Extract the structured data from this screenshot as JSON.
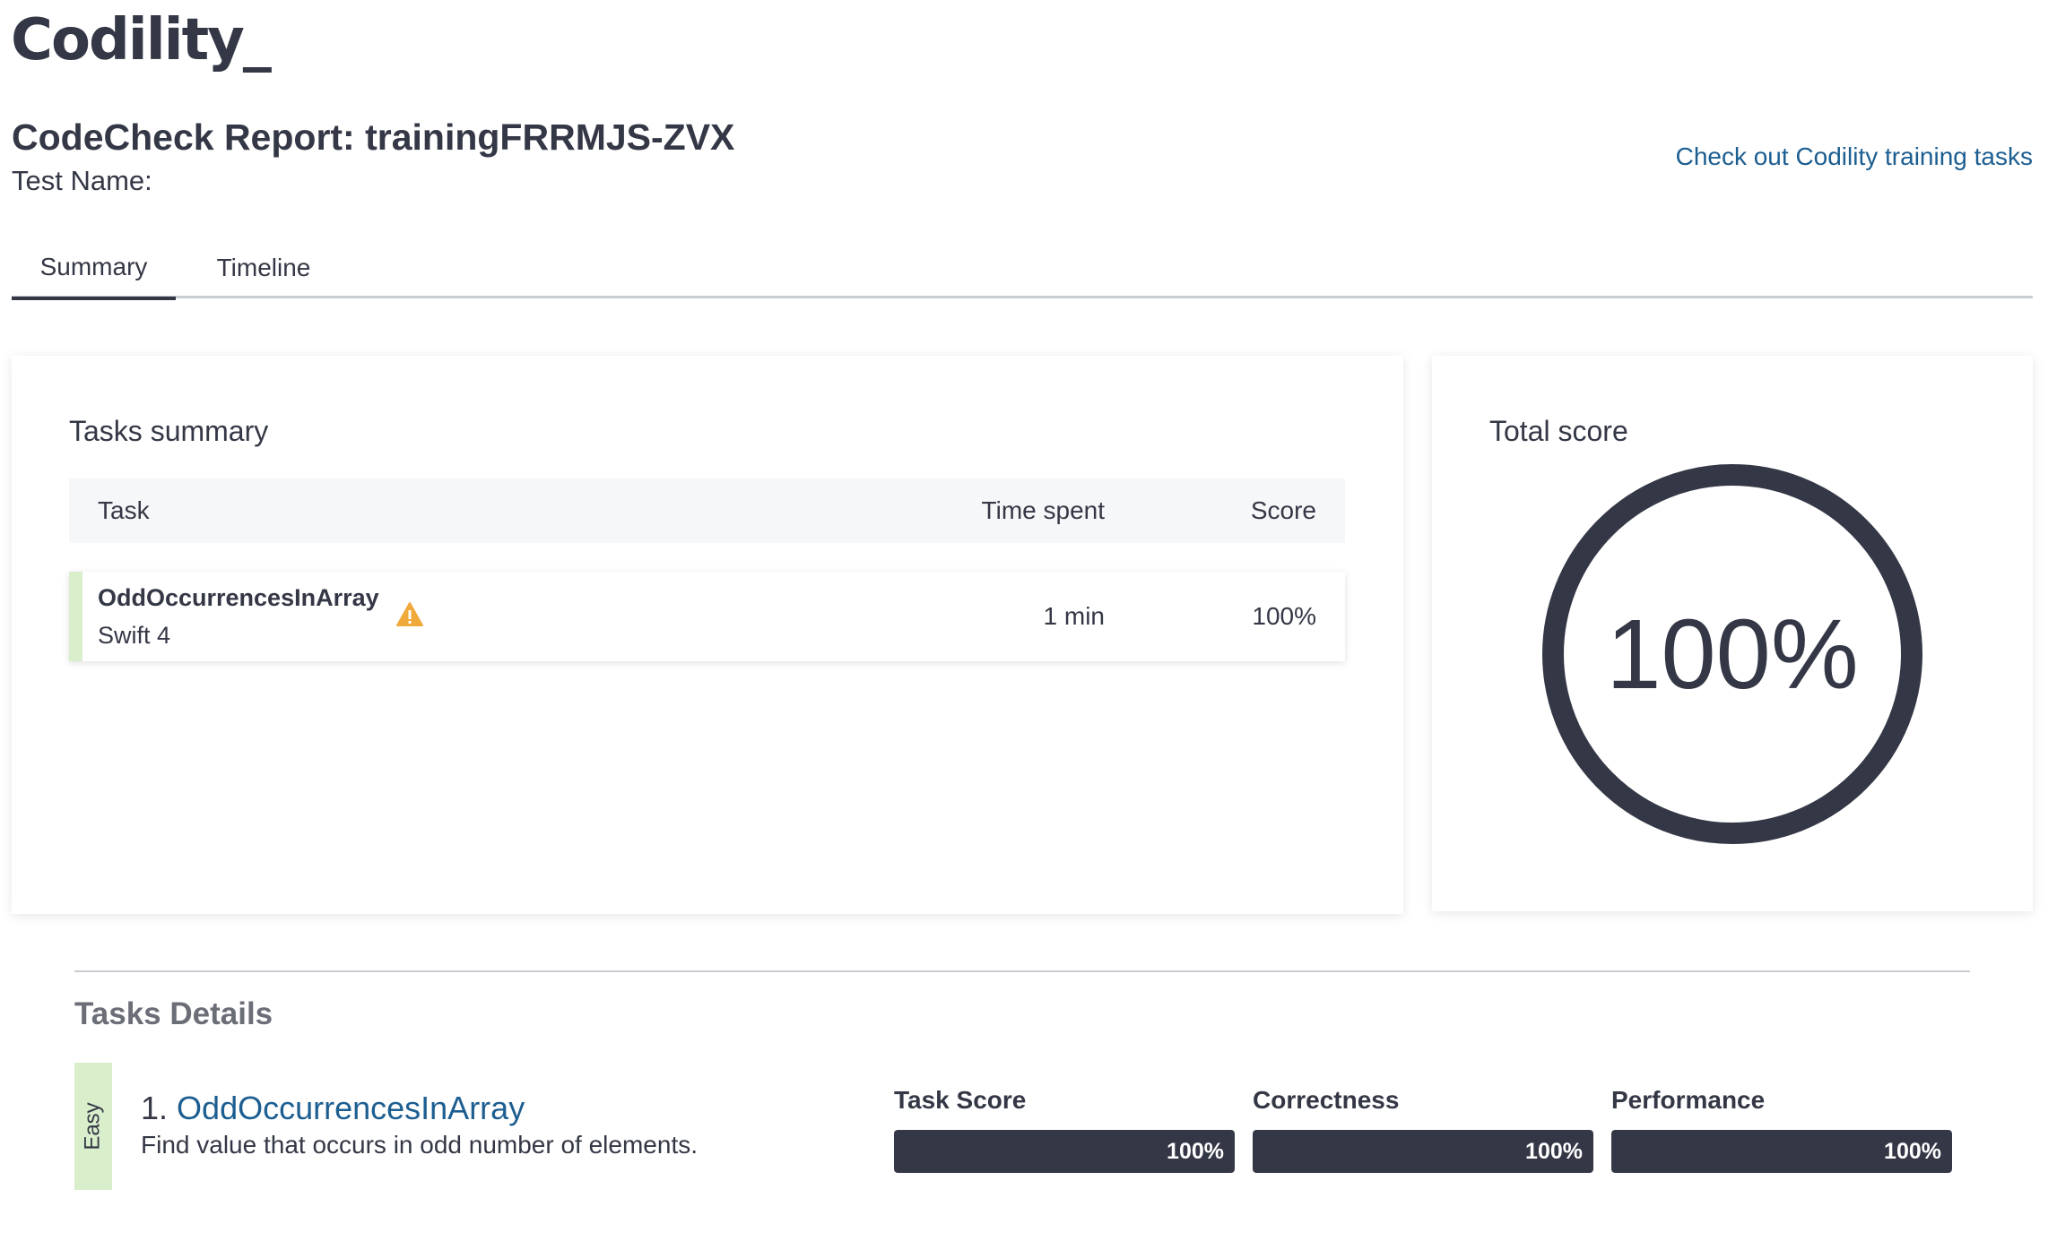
{
  "logo": "Codility_",
  "header": {
    "title": "CodeCheck Report: trainingFRRMJS-ZVX",
    "test_name_label": "Test Name:",
    "training_link": "Check out Codility training tasks"
  },
  "tabs": [
    {
      "label": "Summary",
      "active": true
    },
    {
      "label": "Timeline",
      "active": false
    }
  ],
  "tasks_summary": {
    "title": "Tasks summary",
    "columns": [
      "Task",
      "Time spent",
      "Score"
    ],
    "rows": [
      {
        "task": "OddOccurrencesInArray",
        "language": "Swift 4",
        "warning_icon": "warning-triangle-icon",
        "time_spent": "1 min",
        "score": "100%"
      }
    ]
  },
  "total_score": {
    "title": "Total score",
    "value": "100%"
  },
  "tasks_details": {
    "title": "Tasks Details",
    "items": [
      {
        "difficulty": "Easy",
        "number": "1.",
        "name": "OddOccurrencesInArray",
        "description": "Find value that occurs in odd number of elements.",
        "metrics": [
          {
            "label": "Task Score",
            "value": "100%",
            "fraction": 1.0
          },
          {
            "label": "Correctness",
            "value": "100%",
            "fraction": 1.0
          },
          {
            "label": "Performance",
            "value": "100%",
            "fraction": 1.0
          }
        ]
      }
    ]
  },
  "colors": {
    "primary_dark": "#343745",
    "link_blue": "#1d5e91",
    "easy_green": "#d9eecb",
    "warning_orange": "#f0a93b"
  }
}
